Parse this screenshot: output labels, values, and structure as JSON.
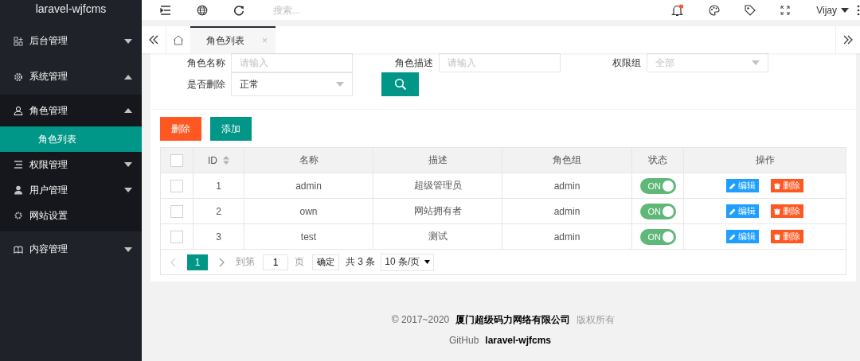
{
  "sidebar": {
    "title": "laravel-wjfcms",
    "items": [
      {
        "label": "后台管理",
        "expanded": false
      },
      {
        "label": "系统管理",
        "expanded": true,
        "children": [
          {
            "label": "角色管理",
            "expanded": true,
            "children": [
              {
                "label": "角色列表",
                "selected": true
              }
            ]
          },
          {
            "label": "权限管理",
            "expanded": false
          },
          {
            "label": "用户管理",
            "expanded": false
          },
          {
            "label": "网站设置"
          }
        ]
      },
      {
        "label": "内容管理",
        "expanded": false
      }
    ]
  },
  "header": {
    "search": {
      "placeholder": "搜索..."
    },
    "notification_unread": true,
    "user": "Vijay"
  },
  "tabs": [
    {
      "label": "角色列表",
      "selected": true,
      "close": "×"
    }
  ],
  "filters": [
    {
      "label": "角色名称",
      "kind": "input",
      "placeholder": "请输入"
    },
    {
      "label": "角色描述",
      "kind": "input",
      "placeholder": "请输入"
    },
    {
      "label": "权限组",
      "kind": "select",
      "placeholder": "全部"
    },
    {
      "label": "是否删除",
      "kind": "select",
      "value": "正常"
    }
  ],
  "toolbar": [
    {
      "label": "删除",
      "kind": "danger"
    },
    {
      "label": "添加",
      "kind": "primary"
    }
  ],
  "table": {
    "select_all": {
      "checked": false
    },
    "columns": [
      "ID",
      "名称",
      "描述",
      "角色组",
      "状态",
      "操作"
    ],
    "rows": [
      {
        "checked": false,
        "id": "1",
        "name": "admin",
        "description": "超级管理员",
        "group": "admin",
        "status": {
          "on": true,
          "label": "ON"
        },
        "actions": [
          "编辑",
          "删除"
        ]
      },
      {
        "checked": false,
        "id": "2",
        "name": "own",
        "description": "网站拥有者",
        "group": "admin",
        "status": {
          "on": true,
          "label": "ON"
        },
        "actions": [
          "编辑",
          "删除"
        ]
      },
      {
        "checked": false,
        "id": "3",
        "name": "test",
        "description": "测试",
        "group": "admin",
        "status": {
          "on": true,
          "label": "ON"
        },
        "actions": [
          "编辑",
          "删除"
        ]
      }
    ]
  },
  "pagination": {
    "pages": [
      {
        "label": "1",
        "selected": true
      }
    ],
    "goto_label": "到第",
    "goto_value": "1",
    "page_unit": "页",
    "confirm": "确定",
    "total": "共 3 条",
    "page_size": "10 条/页"
  },
  "footer": {
    "copyright": "© 2017~2020",
    "company": "厦门超级码力网络有限公司",
    "rights": "版权所有",
    "github_label": "GitHub",
    "github_link": "laravel-wjfcms"
  }
}
